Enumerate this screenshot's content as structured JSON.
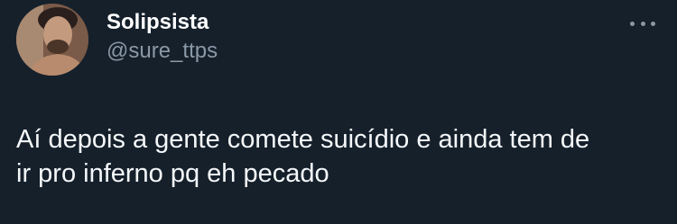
{
  "author": {
    "display_name": "Solipsista",
    "handle": "@sure_ttps",
    "avatar_icon": "profile-photo"
  },
  "menu": {
    "icon": "more-options-icon"
  },
  "tweet": {
    "text": "Aí depois a gente comete suicídio e ainda tem de\nir pro inferno pq eh pecado"
  },
  "colors": {
    "background": "#15202b",
    "primary_text": "#ffffff",
    "secondary_text": "#8b98a5"
  }
}
